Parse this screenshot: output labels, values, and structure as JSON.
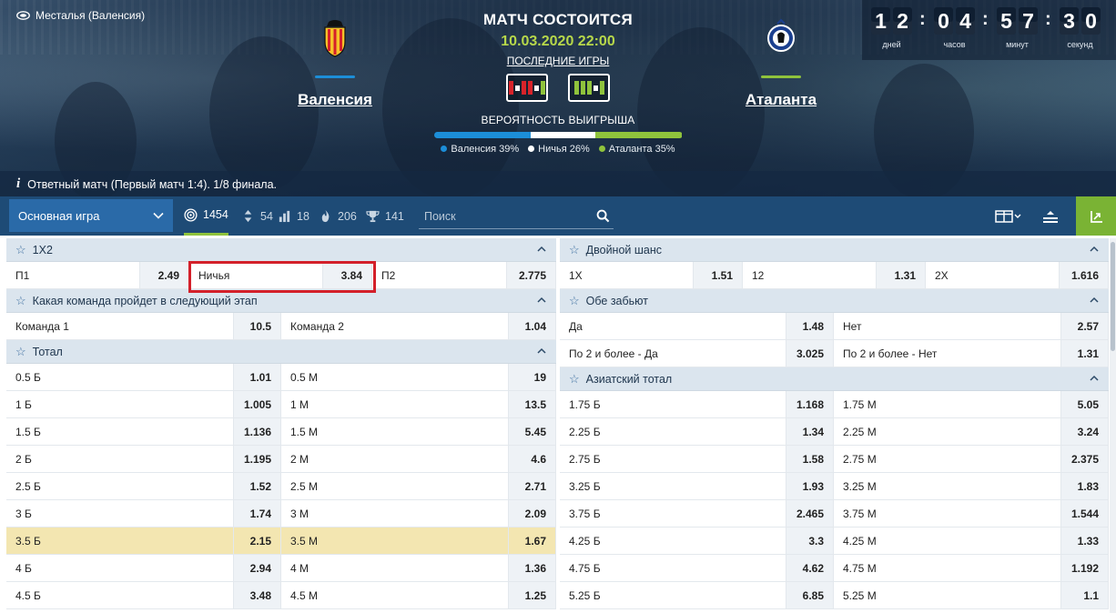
{
  "hero": {
    "venue": "Месталья (Валенсия)",
    "status": "МАТЧ СОСТОИТСЯ",
    "date": "10.03.2020 22:00",
    "last_games_label": "ПОСЛЕДНИЕ ИГРЫ",
    "probability_title": "ВЕРОЯТНОСТЬ ВЫИГРЫША",
    "home_team": {
      "name": "Валенсия",
      "color": "#1c8ed8"
    },
    "away_team": {
      "name": "Аталанта",
      "color": "#8fc33c"
    },
    "probabilities": [
      {
        "label": "Валенсия 39%",
        "value": 39,
        "color": "#1c8ed8"
      },
      {
        "label": "Ничья 26%",
        "value": 26,
        "color": "#ffffff"
      },
      {
        "label": "Аталанта 35%",
        "value": 35,
        "color": "#8fc33c"
      }
    ],
    "home_form": [
      "#d8232a",
      "#ffffff",
      "#d8232a",
      "#d8232a",
      "#ffffff",
      "#8fc33c"
    ],
    "away_form": [
      "#8fc33c",
      "#8fc33c",
      "#8fc33c",
      "#ffffff",
      "#8fc33c"
    ],
    "match_info": "Ответный матч (Первый матч 1:4). 1/8 финала."
  },
  "countdown": {
    "days": [
      "1",
      "2"
    ],
    "days_label": "дней",
    "hours": [
      "0",
      "4"
    ],
    "hours_label": "часов",
    "minutes": [
      "5",
      "7"
    ],
    "minutes_label": "минут",
    "seconds": [
      "3",
      "0"
    ],
    "seconds_label": "секунд"
  },
  "toolbar": {
    "game_select": "Основная игра",
    "total_markets": "1454",
    "stat_updown": "54",
    "stat_bars": "18",
    "stat_fire": "206",
    "stat_trophy": "141",
    "search_placeholder": "Поиск"
  },
  "left_markets": [
    {
      "title": "1X2",
      "rows": [
        [
          {
            "label": "П1",
            "odd": "2.49"
          },
          {
            "label": "Ничья",
            "odd": "3.84"
          },
          {
            "label": "П2",
            "odd": "2.775"
          }
        ]
      ]
    },
    {
      "title": "Какая команда пройдет в следующий этап",
      "rows": [
        [
          {
            "label": "Команда 1",
            "odd": "10.5"
          },
          {
            "label": "Команда 2",
            "odd": "1.04"
          }
        ]
      ]
    },
    {
      "title": "Тотал",
      "rows": [
        [
          {
            "label": "0.5 Б",
            "odd": "1.01"
          },
          {
            "label": "0.5 М",
            "odd": "19"
          }
        ],
        [
          {
            "label": "1 Б",
            "odd": "1.005"
          },
          {
            "label": "1 М",
            "odd": "13.5"
          }
        ],
        [
          {
            "label": "1.5 Б",
            "odd": "1.136"
          },
          {
            "label": "1.5 М",
            "odd": "5.45"
          }
        ],
        [
          {
            "label": "2 Б",
            "odd": "1.195"
          },
          {
            "label": "2 М",
            "odd": "4.6"
          }
        ],
        [
          {
            "label": "2.5 Б",
            "odd": "1.52"
          },
          {
            "label": "2.5 М",
            "odd": "2.71"
          }
        ],
        [
          {
            "label": "3 Б",
            "odd": "1.74"
          },
          {
            "label": "3 М",
            "odd": "2.09"
          }
        ],
        [
          {
            "label": "3.5 Б",
            "odd": "2.15"
          },
          {
            "label": "3.5 М",
            "odd": "1.67"
          }
        ],
        [
          {
            "label": "4 Б",
            "odd": "2.94"
          },
          {
            "label": "4 М",
            "odd": "1.36"
          }
        ],
        [
          {
            "label": "4.5 Б",
            "odd": "3.48"
          },
          {
            "label": "4.5 М",
            "odd": "1.25"
          }
        ]
      ]
    }
  ],
  "right_markets": [
    {
      "title": "Двойной шанс",
      "rows": [
        [
          {
            "label": "1X",
            "odd": "1.51"
          },
          {
            "label": "12",
            "odd": "1.31"
          },
          {
            "label": "2X",
            "odd": "1.616"
          }
        ]
      ]
    },
    {
      "title": "Обе забьют",
      "rows": [
        [
          {
            "label": "Да",
            "odd": "1.48"
          },
          {
            "label": "Нет",
            "odd": "2.57"
          }
        ],
        [
          {
            "label": "По 2 и более - Да",
            "odd": "3.025"
          },
          {
            "label": "По 2 и более - Нет",
            "odd": "1.31"
          }
        ]
      ]
    },
    {
      "title": "Азиатский тотал",
      "rows": [
        [
          {
            "label": "1.75 Б",
            "odd": "1.168"
          },
          {
            "label": "1.75 М",
            "odd": "5.05"
          }
        ],
        [
          {
            "label": "2.25 Б",
            "odd": "1.34"
          },
          {
            "label": "2.25 М",
            "odd": "3.24"
          }
        ],
        [
          {
            "label": "2.75 Б",
            "odd": "1.58"
          },
          {
            "label": "2.75 М",
            "odd": "2.375"
          }
        ],
        [
          {
            "label": "3.25 Б",
            "odd": "1.93"
          },
          {
            "label": "3.25 М",
            "odd": "1.83"
          }
        ],
        [
          {
            "label": "3.75 Б",
            "odd": "2.465"
          },
          {
            "label": "3.75 М",
            "odd": "1.544"
          }
        ],
        [
          {
            "label": "4.25 Б",
            "odd": "3.3"
          },
          {
            "label": "4.25 М",
            "odd": "1.33"
          }
        ],
        [
          {
            "label": "4.75 Б",
            "odd": "4.62"
          },
          {
            "label": "4.75 М",
            "odd": "1.192"
          }
        ],
        [
          {
            "label": "5.25 Б",
            "odd": "6.85"
          },
          {
            "label": "5.25 М",
            "odd": "1.1"
          }
        ]
      ]
    }
  ]
}
